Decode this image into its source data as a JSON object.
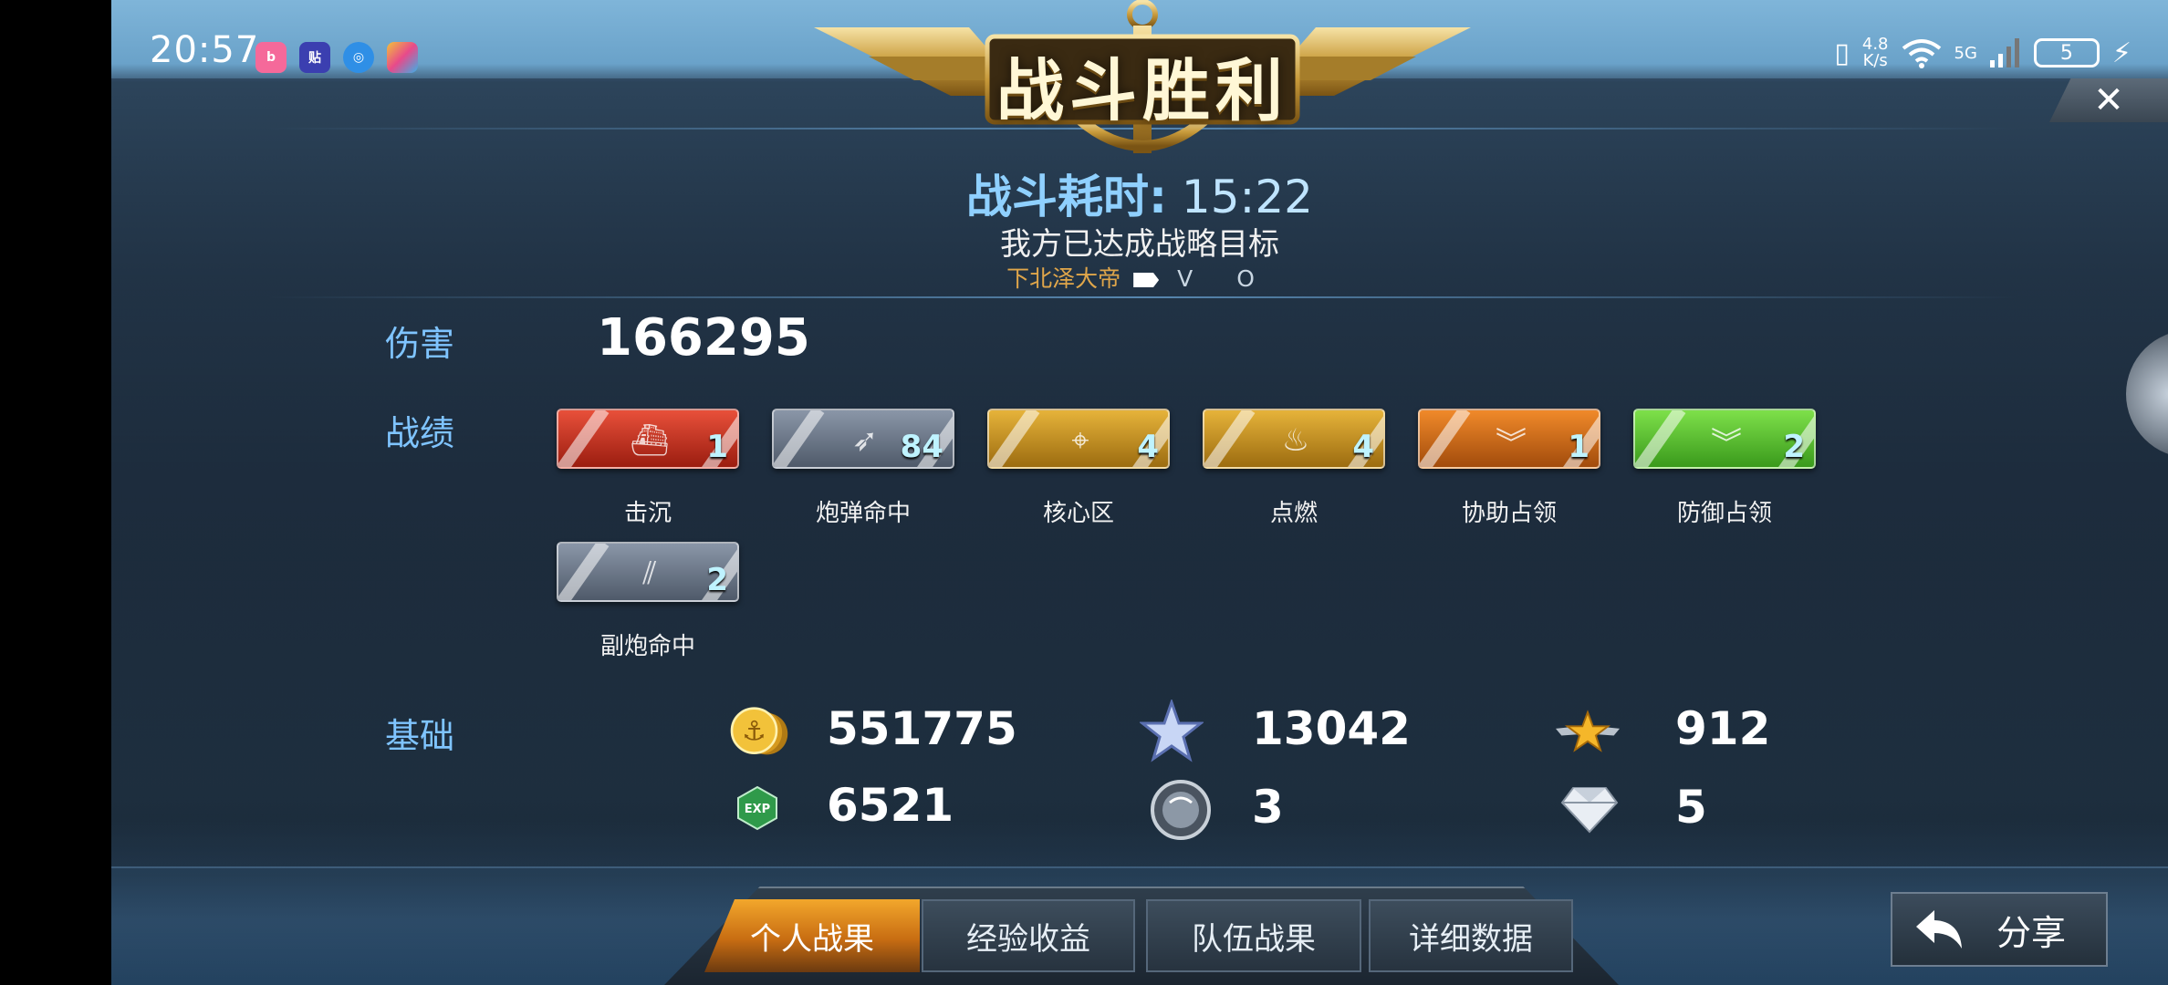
{
  "status_bar": {
    "time": "20:57",
    "net_speed_value": "4.8",
    "net_speed_unit": "K/s",
    "signal": "5G",
    "battery": "5",
    "app_icons": [
      "bilibili-icon",
      "tieba-icon",
      "browser-icon",
      "palette-app-icon"
    ]
  },
  "header": {
    "title": "战斗胜利",
    "battle_time_label": "战斗耗时:",
    "battle_time_value": "15:22",
    "goal_text": "我方已达成战略目标",
    "player_name": "下北泽大帝",
    "player_suffix": "V O"
  },
  "stats": {
    "damage_label": "伤害",
    "damage_value": "166295",
    "record_label": "战绩",
    "medals": [
      {
        "label": "击沉",
        "count": "1",
        "color_top": "#e8503a",
        "color_bottom": "#9b1d10",
        "icon": "sink-icon"
      },
      {
        "label": "炮弹命中",
        "count": "84",
        "color_top": "#8a96a8",
        "color_bottom": "#4f5a6a",
        "icon": "shell-hit-icon"
      },
      {
        "label": "核心区",
        "count": "4",
        "color_top": "#e6b33a",
        "color_bottom": "#9c6c10",
        "icon": "citadel-icon"
      },
      {
        "label": "点燃",
        "count": "4",
        "color_top": "#e6b33a",
        "color_bottom": "#9c6c10",
        "icon": "fire-icon"
      },
      {
        "label": "协助占领",
        "count": "1",
        "color_top": "#f08a2a",
        "color_bottom": "#a24c0c",
        "icon": "assist-capture-icon"
      },
      {
        "label": "防御占领",
        "count": "2",
        "color_top": "#7ee04a",
        "color_bottom": "#3a9a1c",
        "icon": "defend-capture-icon"
      },
      {
        "label": "副炮命中",
        "count": "2",
        "color_top": "#8a96a8",
        "color_bottom": "#4f5a6a",
        "icon": "secondary-hit-icon"
      }
    ],
    "base_label": "基础",
    "resources": [
      {
        "icon": "gold-coin-icon",
        "value": "551775"
      },
      {
        "icon": "blue-star-icon",
        "value": "13042"
      },
      {
        "icon": "gold-star-icon",
        "value": "912"
      },
      {
        "icon": "exp-icon",
        "value": "6521",
        "icon_text": "EXP"
      },
      {
        "icon": "silver-orb-icon",
        "value": "3"
      },
      {
        "icon": "diamond-icon",
        "value": "5"
      }
    ]
  },
  "tabs": [
    {
      "label": "个人战果",
      "active": true
    },
    {
      "label": "经验收益",
      "active": false
    },
    {
      "label": "队伍战果",
      "active": false
    },
    {
      "label": "详细数据",
      "active": false
    }
  ],
  "share_label": "分享",
  "colors": {
    "label_blue": "#7fc4ff",
    "tab_active": "#e8961f",
    "gold": "#e0a64a"
  }
}
